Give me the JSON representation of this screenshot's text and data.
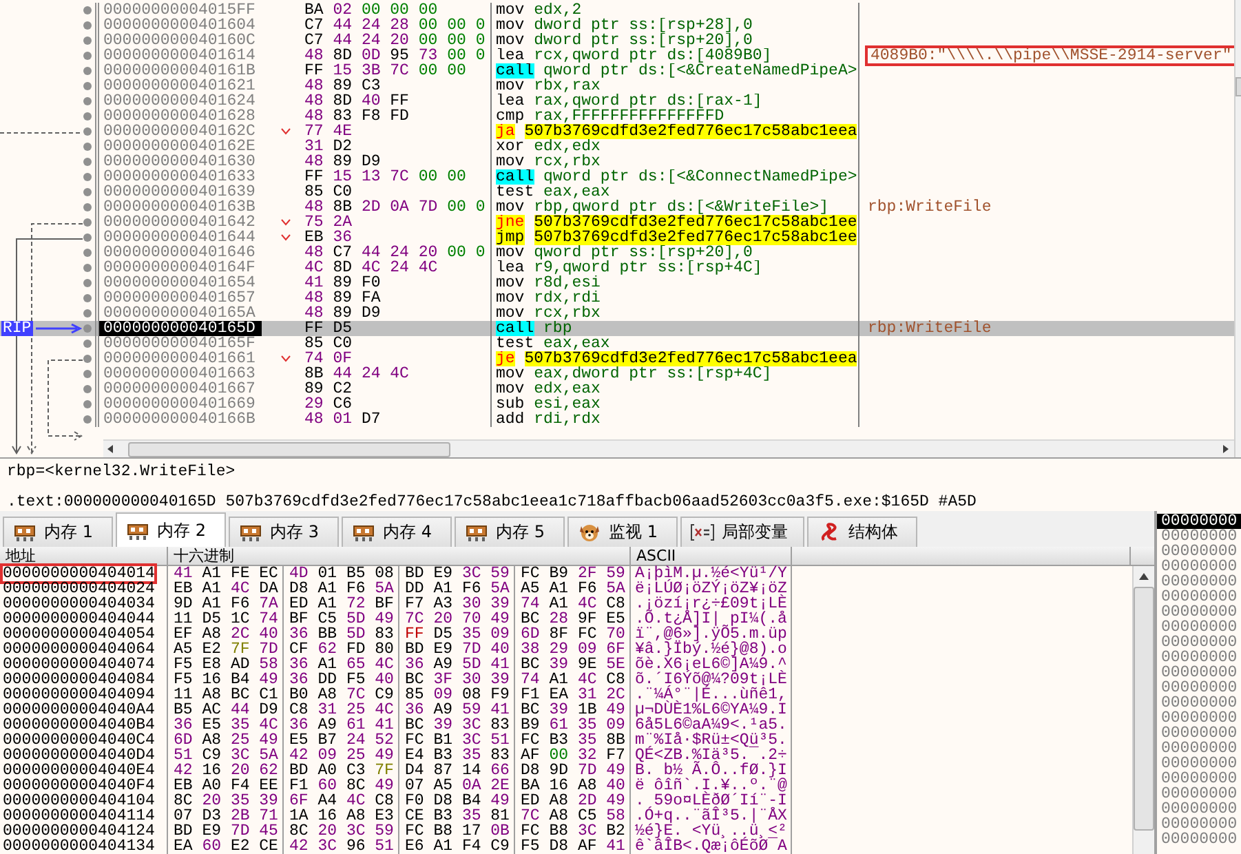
{
  "disasm": {
    "rows": [
      {
        "address": "00000000004015FF",
        "bytes": "BA 02 00 00 00",
        "kind": "plain",
        "mnemonic": "mov",
        "operands": "edx,2",
        "selected": false
      },
      {
        "address": "0000000000401604",
        "bytes": "C7 44 24 28 00 00 0",
        "kind": "plain",
        "mnemonic": "mov",
        "operands": "dword ptr ss:[rsp+28],0",
        "selected": false
      },
      {
        "address": "000000000040160C",
        "bytes": "C7 44 24 20 00 00 0",
        "kind": "plain",
        "mnemonic": "mov",
        "operands": "dword ptr ss:[rsp+20],0",
        "selected": false
      },
      {
        "address": "0000000000401614",
        "bytes": "48 8D 0D 95 73 00 0",
        "kind": "plain",
        "mnemonic": "lea",
        "operands": "rcx,qword ptr ds:[4089B0]",
        "selected": false,
        "comment": "4089B0:\"\\\\\\\\.\\\\pipe\\\\MSSE-2914-server\"",
        "annotated": true
      },
      {
        "address": "000000000040161B",
        "bytes": "FF 15 3B 7C 00 00",
        "kind": "call",
        "mnemonic": "call",
        "operands": "qword ptr ds:[<&CreateNamedPipeA>",
        "selected": false
      },
      {
        "address": "0000000000401621",
        "bytes": "48 89 C3",
        "kind": "plain",
        "mnemonic": "mov",
        "operands": "rbx,rax",
        "selected": false
      },
      {
        "address": "0000000000401624",
        "bytes": "48 8D 40 FF",
        "kind": "plain",
        "mnemonic": "lea",
        "operands": "rax,qword ptr ds:[rax-1]",
        "selected": false
      },
      {
        "address": "0000000000401628",
        "bytes": "48 83 F8 FD",
        "kind": "plain",
        "mnemonic": "cmp",
        "operands": "rax,FFFFFFFFFFFFFFFD",
        "selected": false
      },
      {
        "address": "000000000040162C",
        "bytes": "77 4E",
        "kind": "branch",
        "mnemonic": "ja",
        "operands": "507b3769cdfd3e2fed776ec17c58abc1eea",
        "selected": false
      },
      {
        "address": "000000000040162E",
        "bytes": "31 D2",
        "kind": "plain",
        "mnemonic": "xor",
        "operands": "edx,edx",
        "selected": false
      },
      {
        "address": "0000000000401630",
        "bytes": "48 89 D9",
        "kind": "plain",
        "mnemonic": "mov",
        "operands": "rcx,rbx",
        "selected": false
      },
      {
        "address": "0000000000401633",
        "bytes": "FF 15 13 7C 00 00",
        "kind": "call",
        "mnemonic": "call",
        "operands": "qword ptr ds:[<&ConnectNamedPipe>",
        "selected": false
      },
      {
        "address": "0000000000401639",
        "bytes": "85 C0",
        "kind": "plain",
        "mnemonic": "test",
        "operands": "eax,eax",
        "selected": false
      },
      {
        "address": "000000000040163B",
        "bytes": "48 8B 2D 0A 7D 00 0",
        "kind": "plain",
        "mnemonic": "mov",
        "operands": "rbp,qword ptr ds:[<&WriteFile>]",
        "selected": false,
        "comment": "rbp:WriteFile",
        "annotated": false
      },
      {
        "address": "0000000000401642",
        "bytes": "75 2A",
        "kind": "branch",
        "mnemonic": "jne",
        "operands": "507b3769cdfd3e2fed776ec17c58abc1ee",
        "selected": false
      },
      {
        "address": "0000000000401644",
        "bytes": "EB 36",
        "kind": "jump",
        "mnemonic": "jmp",
        "operands": "507b3769cdfd3e2fed776ec17c58abc1ee",
        "selected": false
      },
      {
        "address": "0000000000401646",
        "bytes": "48 C7 44 24 20 00 0",
        "kind": "plain",
        "mnemonic": "mov",
        "operands": "qword ptr ss:[rsp+20],0",
        "selected": false
      },
      {
        "address": "000000000040164F",
        "bytes": "4C 8D 4C 24 4C",
        "kind": "plain",
        "mnemonic": "lea",
        "operands": "r9,qword ptr ss:[rsp+4C]",
        "selected": false
      },
      {
        "address": "0000000000401654",
        "bytes": "41 89 F0",
        "kind": "plain",
        "mnemonic": "mov",
        "operands": "r8d,esi",
        "selected": false
      },
      {
        "address": "0000000000401657",
        "bytes": "48 89 FA",
        "kind": "plain",
        "mnemonic": "mov",
        "operands": "rdx,rdi",
        "selected": false
      },
      {
        "address": "000000000040165A",
        "bytes": "48 89 D9",
        "kind": "plain",
        "mnemonic": "mov",
        "operands": "rcx,rbx",
        "selected": false
      },
      {
        "address": "000000000040165D",
        "bytes": "FF D5",
        "kind": "call",
        "mnemonic": "call",
        "operands": "rbp",
        "selected": true,
        "ip_label": "RIP",
        "comment": "rbp:WriteFile",
        "annotated": false
      },
      {
        "address": "000000000040165F",
        "bytes": "85 C0",
        "kind": "plain",
        "mnemonic": "test",
        "operands": "eax,eax",
        "selected": false
      },
      {
        "address": "0000000000401661",
        "bytes": "74 0F",
        "kind": "branch",
        "mnemonic": "je",
        "operands": "507b3769cdfd3e2fed776ec17c58abc1eea",
        "selected": false
      },
      {
        "address": "0000000000401663",
        "bytes": "8B 44 24 4C",
        "kind": "plain",
        "mnemonic": "mov",
        "operands": "eax,dword ptr ss:[rsp+4C]",
        "selected": false
      },
      {
        "address": "0000000000401667",
        "bytes": "89 C2",
        "kind": "plain",
        "mnemonic": "mov",
        "operands": "edx,eax",
        "selected": false
      },
      {
        "address": "0000000000401669",
        "bytes": "29 C6",
        "kind": "plain",
        "mnemonic": "sub",
        "operands": "esi,eax",
        "selected": false
      },
      {
        "address": "000000000040166B",
        "bytes": "48 01 D7",
        "kind": "plain",
        "mnemonic": "add",
        "operands": "rdi,rdx",
        "selected": false
      }
    ]
  },
  "info": {
    "line_1": "rbp=<kernel32.WriteFile>",
    "line_2": ".text:000000000040165D 507b3769cdfd3e2fed776ec17c58abc1eea1c718affbacb06aad52603cc0a3f5.exe:$165D #A5D"
  },
  "tabs": [
    {
      "label": "内存 1",
      "kind": "memory",
      "selected": false
    },
    {
      "label": "内存 2",
      "kind": "memory",
      "selected": true
    },
    {
      "label": "内存 3",
      "kind": "memory",
      "selected": false
    },
    {
      "label": "内存 4",
      "kind": "memory",
      "selected": false
    },
    {
      "label": "内存 5",
      "kind": "memory",
      "selected": false
    },
    {
      "label": "监视 1",
      "kind": "watch",
      "selected": false
    },
    {
      "label": "局部变量",
      "kind": "locals",
      "selected": false
    },
    {
      "label": "结构体",
      "kind": "struct",
      "selected": false
    }
  ],
  "dump": {
    "columns": [
      "地址",
      "十六进制",
      "ASCII"
    ],
    "rows": [
      {
        "address": "0000000000404014",
        "annotated": true,
        "hex": [
          "41 A1 FE EC",
          "4D 01 B5 08",
          "BD E9 3C 59",
          "FC B9 2F 59"
        ],
        "ascii": "A¡þìM.µ.½é<Yü¹/Y"
      },
      {
        "address": "0000000000404024",
        "annotated": false,
        "hex": [
          "EB A1 4C DA",
          "D8 A1 F6 5A",
          "DD A1 F6 5A",
          "A5 A1 F6 5A"
        ],
        "ascii": "ë¡LÚØ¡öZÝ¡öZ¥¡öZ"
      },
      {
        "address": "0000000000404034",
        "annotated": false,
        "hex": [
          "9D A1 F6 7A",
          "ED A1 72 BF",
          "F7 A3 30 39",
          "74 A1 4C C8"
        ],
        "ascii": ".¡özí¡r¿÷£09t¡LÈ"
      },
      {
        "address": "0000000000404044",
        "annotated": false,
        "hex": [
          "11 D5 1C 74",
          "BF C5 5D 49",
          "7C 20 70 49",
          "BC 28 9F E5"
        ],
        "ascii": ".Õ.t¿Å]I| pI¼(.å"
      },
      {
        "address": "0000000000404054",
        "annotated": false,
        "hex": [
          "EF A8 2C 40",
          "36 BB 5D 83",
          "FF D5 35 09",
          "6D 8F FC 70"
        ],
        "ascii": "ï¨,@6»].ÿÕ5.m.üp"
      },
      {
        "address": "0000000000404064",
        "annotated": false,
        "hex": [
          "A5 E2 7F 7D",
          "CF 62 FD 80",
          "BD E9 7D 40",
          "38 29 09 6F"
        ],
        "ascii": "¥â.}Ïbý.½é}@8).o"
      },
      {
        "address": "0000000000404074",
        "annotated": false,
        "hex": [
          "F5 E8 AD 58",
          "36 A1 65 4C",
          "36 A9 5D 41",
          "BC 39 9E 5E"
        ],
        "ascii": "õè.X6¡eL6©]A¼9.^"
      },
      {
        "address": "0000000000404084",
        "annotated": false,
        "hex": [
          "F5 16 B4 49",
          "36 DD F5 40",
          "BC 3F 30 39",
          "74 A1 4C C8"
        ],
        "ascii": "õ.´I6Ýõ@¼?09t¡LÈ"
      },
      {
        "address": "0000000000404094",
        "annotated": false,
        "hex": [
          "11 A8 BC C1",
          "B0 A8 7C C9",
          "85 09 08 F9",
          "F1 EA 31 2C"
        ],
        "ascii": ".¨¼Á°¨|É...ùñê1,"
      },
      {
        "address": "00000000004040A4",
        "annotated": false,
        "hex": [
          "B5 AC 44 D9",
          "C8 31 25 4C",
          "36 A9 59 41",
          "BC 39 1B 49"
        ],
        "ascii": "µ¬DÙÈ1%L6©YA¼9.I"
      },
      {
        "address": "00000000004040B4",
        "annotated": false,
        "hex": [
          "36 E5 35 4C",
          "36 A9 61 41",
          "BC 39 3C 83",
          "B9 61 35 09"
        ],
        "ascii": "6å5L6©aA¼9<.¹a5."
      },
      {
        "address": "00000000004040C4",
        "annotated": false,
        "hex": [
          "6D A8 25 49",
          "E5 B7 24 52",
          "FC B1 3C 51",
          "FC B3 35 8B"
        ],
        "ascii": "m¨%Iå·$Rü±<Qü³5."
      },
      {
        "address": "00000000004040D4",
        "annotated": false,
        "hex": [
          "51 C9 3C 5A",
          "42 09 25 49",
          "E4 B3 35 83",
          "AF 00 32 F7"
        ],
        "ascii": "QÉ<ZB.%Iä³5.¯.2÷"
      },
      {
        "address": "00000000004040E4",
        "annotated": false,
        "hex": [
          "42 16 20 62",
          "BD A0 C3 7F",
          "D4 87 14 66",
          "D8 9D 7D 49"
        ],
        "ascii": "B. b½ Ã.Ô..fØ.}I"
      },
      {
        "address": "00000000004040F4",
        "annotated": false,
        "hex": [
          "EB A0 F4 EE",
          "F1 60 8C 49",
          "07 A5 0A 2E",
          "BA 16 A8 40"
        ],
        "ascii": "ë ôîñ`.I.¥..º.¨@"
      },
      {
        "address": "0000000000404104",
        "annotated": false,
        "hex": [
          "8C 20 35 39",
          "6F A4 4C C8",
          "F0 D8 B4 49",
          "ED A8 2D 49"
        ],
        "ascii": ". 59o¤LÈðØ´Ií¨-I"
      },
      {
        "address": "0000000000404114",
        "annotated": false,
        "hex": [
          "07 D3 2B 71",
          "1A 16 A8 E3",
          "CE B3 35 81",
          "7C A8 C5 58"
        ],
        "ascii": ".Ó+q..¨ãÎ³5.|¨ÅX"
      },
      {
        "address": "0000000000404124",
        "annotated": false,
        "hex": [
          "BD E9 7D 45",
          "8C 20 3C 59",
          "FC B8 17 0B",
          "FC B8 3C B2"
        ],
        "ascii": "½é}E. <Yü¸..ü¸<²"
      },
      {
        "address": "0000000000404134",
        "annotated": false,
        "hex": [
          "EA 60 E2 CE",
          "42 3C 96 51",
          "E6 A1 F4 C9",
          "F5 D8 AF 41"
        ],
        "ascii": "ê`âÎB<.Qæ¡ôÉõØ¯A"
      }
    ]
  },
  "stack": {
    "rows": [
      {
        "value": "00000000",
        "selected": true
      },
      {
        "value": "00000000",
        "selected": false
      },
      {
        "value": "00000000",
        "selected": false
      },
      {
        "value": "00000000",
        "selected": false
      },
      {
        "value": "00000000",
        "selected": false
      },
      {
        "value": "00000000",
        "selected": false
      },
      {
        "value": "00000000",
        "selected": false
      },
      {
        "value": "00000000",
        "selected": false
      },
      {
        "value": "00000000",
        "selected": false
      },
      {
        "value": "00000000",
        "selected": false
      },
      {
        "value": "00000000",
        "selected": false
      },
      {
        "value": "00000000",
        "selected": false
      },
      {
        "value": "00000000",
        "selected": false
      },
      {
        "value": "00000000",
        "selected": false
      },
      {
        "value": "00000000",
        "selected": false
      },
      {
        "value": "00000000",
        "selected": false
      },
      {
        "value": "00000000",
        "selected": false
      },
      {
        "value": "00000000",
        "selected": false
      },
      {
        "value": "00000000",
        "selected": false
      },
      {
        "value": "00000000",
        "selected": false
      },
      {
        "value": "00000000",
        "selected": false
      },
      {
        "value": "00000000",
        "selected": false
      }
    ]
  }
}
